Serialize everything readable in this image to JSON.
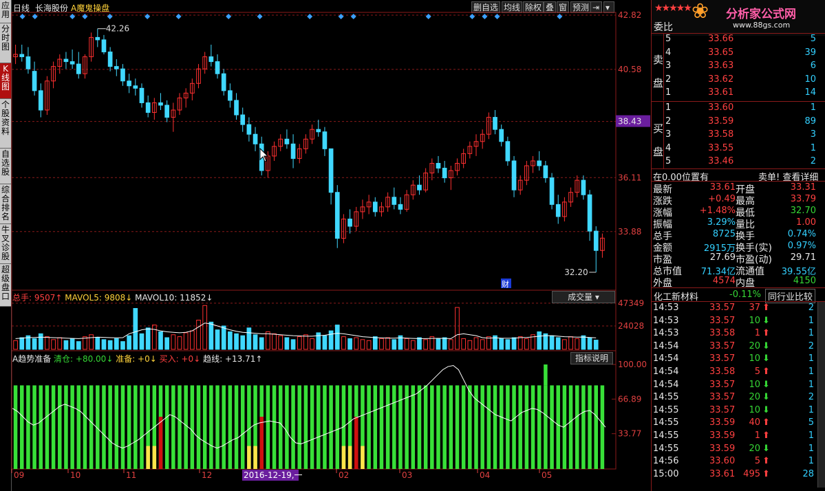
{
  "sidebar": {
    "tabs": [
      {
        "label": "应用",
        "active": false
      },
      {
        "label": "分时图",
        "active": false
      },
      {
        "label": "K线图",
        "active": true
      },
      {
        "label": "个股资料",
        "active": false
      },
      {
        "label": "自选股",
        "active": false
      },
      {
        "label": "综合排名",
        "active": false
      },
      {
        "label": "牛叉诊股",
        "active": false
      },
      {
        "label": "超级盘口",
        "active": false
      }
    ]
  },
  "toolbar": {
    "period": "日线",
    "stock": "长海股份",
    "indicator": "A魔鬼操盘",
    "buttons": [
      "删自选",
      "均线",
      "除权",
      "叠",
      "窗",
      "预测"
    ]
  },
  "chart_data": [
    {
      "type": "candlestick",
      "title": "日线",
      "y_ticks": [
        "42.82",
        "40.58",
        "38.43",
        "36.11",
        "33.88"
      ],
      "current_price_label": "38.43",
      "annotations": [
        "42.26",
        "32.20",
        "财"
      ],
      "ylim": [
        31.8,
        42.82
      ],
      "candles": [
        [
          41.1,
          41.6,
          40.8,
          41.2
        ],
        [
          41.2,
          41.6,
          40.9,
          41.1
        ],
        [
          41.1,
          41.5,
          40.4,
          40.6
        ],
        [
          40.5,
          40.9,
          39.5,
          39.7
        ],
        [
          39.7,
          40.0,
          38.6,
          38.9
        ],
        [
          38.9,
          40.3,
          38.7,
          40.1
        ],
        [
          40.1,
          40.9,
          39.8,
          40.7
        ],
        [
          40.7,
          41.2,
          40.4,
          41.0
        ],
        [
          41.0,
          41.3,
          40.6,
          40.9
        ],
        [
          40.9,
          41.4,
          40.6,
          40.8
        ],
        [
          40.8,
          41.3,
          40.2,
          40.4
        ],
        [
          40.4,
          41.2,
          40.2,
          41.1
        ],
        [
          41.1,
          42.1,
          40.9,
          41.9
        ],
        [
          41.9,
          42.26,
          41.5,
          41.8
        ],
        [
          41.8,
          42.0,
          41.2,
          41.3
        ],
        [
          41.3,
          41.5,
          40.5,
          40.7
        ],
        [
          40.7,
          41.0,
          40.3,
          40.6
        ],
        [
          40.6,
          40.8,
          39.9,
          40.1
        ],
        [
          40.1,
          40.4,
          39.6,
          39.9
        ],
        [
          39.9,
          40.2,
          39.5,
          39.8
        ],
        [
          39.8,
          40.0,
          39.0,
          39.2
        ],
        [
          39.2,
          39.5,
          38.6,
          38.8
        ],
        [
          38.8,
          39.4,
          38.5,
          39.2
        ],
        [
          39.2,
          39.6,
          38.9,
          39.1
        ],
        [
          39.1,
          39.3,
          38.4,
          38.6
        ],
        [
          38.6,
          39.2,
          38.0,
          38.9
        ],
        [
          38.9,
          39.6,
          38.7,
          39.4
        ],
        [
          39.4,
          39.8,
          39.0,
          39.6
        ],
        [
          39.6,
          40.2,
          39.3,
          40.0
        ],
        [
          40.0,
          40.8,
          39.8,
          40.6
        ],
        [
          40.6,
          41.3,
          40.4,
          41.1
        ],
        [
          41.1,
          41.6,
          40.7,
          40.9
        ],
        [
          40.9,
          41.2,
          40.2,
          40.4
        ],
        [
          40.4,
          40.6,
          39.5,
          39.7
        ],
        [
          39.7,
          40.0,
          39.0,
          39.3
        ],
        [
          39.3,
          39.6,
          38.5,
          38.7
        ],
        [
          38.7,
          39.0,
          38.0,
          38.3
        ],
        [
          38.3,
          38.6,
          37.6,
          37.9
        ],
        [
          37.9,
          38.2,
          37.2,
          37.5
        ],
        [
          37.5,
          37.8,
          36.2,
          36.4
        ],
        [
          36.4,
          37.2,
          36.1,
          37.0
        ],
        [
          37.0,
          37.6,
          36.8,
          37.4
        ],
        [
          37.4,
          37.9,
          37.2,
          37.7
        ],
        [
          37.7,
          38.1,
          37.3,
          37.5
        ],
        [
          37.5,
          37.9,
          36.5,
          36.9
        ],
        [
          36.9,
          37.5,
          36.7,
          37.3
        ],
        [
          37.3,
          37.9,
          37.1,
          37.7
        ],
        [
          37.7,
          38.3,
          37.5,
          38.1
        ],
        [
          38.1,
          38.5,
          37.8,
          38.0
        ],
        [
          38.0,
          38.2,
          37.0,
          37.3
        ],
        [
          37.3,
          36.5,
          35.0,
          35.5
        ],
        [
          35.5,
          35.8,
          33.2,
          33.6
        ],
        [
          33.6,
          34.6,
          33.4,
          34.4
        ],
        [
          34.4,
          34.8,
          33.8,
          34.1
        ],
        [
          34.1,
          34.9,
          33.9,
          34.7
        ],
        [
          34.7,
          35.2,
          34.4,
          34.9
        ],
        [
          34.9,
          35.4,
          34.6,
          35.1
        ],
        [
          35.1,
          35.3,
          34.5,
          34.7
        ],
        [
          34.7,
          35.1,
          34.5,
          34.9
        ],
        [
          34.9,
          35.5,
          34.7,
          35.3
        ],
        [
          35.3,
          35.7,
          34.8,
          35.0
        ],
        [
          35.0,
          35.3,
          34.6,
          34.8
        ],
        [
          34.8,
          35.6,
          34.7,
          35.4
        ],
        [
          35.4,
          36.0,
          35.2,
          35.8
        ],
        [
          35.8,
          36.2,
          35.4,
          35.6
        ],
        [
          35.6,
          36.5,
          35.5,
          36.3
        ],
        [
          36.3,
          36.9,
          36.0,
          36.7
        ],
        [
          36.7,
          37.0,
          36.3,
          36.5
        ],
        [
          36.5,
          36.8,
          35.9,
          36.1
        ],
        [
          36.1,
          36.6,
          35.6,
          36.4
        ],
        [
          36.4,
          36.9,
          36.2,
          36.7
        ],
        [
          36.7,
          37.3,
          36.5,
          37.1
        ],
        [
          37.1,
          37.6,
          36.9,
          37.4
        ],
        [
          37.4,
          37.9,
          37.0,
          37.6
        ],
        [
          37.6,
          38.1,
          37.3,
          37.9
        ],
        [
          37.9,
          38.8,
          37.7,
          38.6
        ],
        [
          38.6,
          38.9,
          37.9,
          38.1
        ],
        [
          38.1,
          38.3,
          37.4,
          37.6
        ],
        [
          37.6,
          37.8,
          36.6,
          36.8
        ],
        [
          36.8,
          37.0,
          35.3,
          35.6
        ],
        [
          35.6,
          36.2,
          35.4,
          36.0
        ],
        [
          36.0,
          36.8,
          35.8,
          36.6
        ],
        [
          36.6,
          37.0,
          36.3,
          36.8
        ],
        [
          36.8,
          37.2,
          36.4,
          36.6
        ],
        [
          36.6,
          36.8,
          35.9,
          36.1
        ],
        [
          36.1,
          36.3,
          34.8,
          35.0
        ],
        [
          35.0,
          35.4,
          34.2,
          34.5
        ],
        [
          34.5,
          35.3,
          34.3,
          35.1
        ],
        [
          35.1,
          35.7,
          34.9,
          35.5
        ],
        [
          35.5,
          36.2,
          35.3,
          36.0
        ],
        [
          36.0,
          36.2,
          35.2,
          35.4
        ],
        [
          35.4,
          35.6,
          33.5,
          33.9
        ],
        [
          33.9,
          34.1,
          32.2,
          33.1
        ],
        [
          33.1,
          33.8,
          32.8,
          33.61
        ]
      ]
    },
    {
      "type": "bar",
      "title": "成交量",
      "legend": [
        "总手: 9507↑",
        "MAVOL5: 9808↓",
        "MAVOL10: 11852↓"
      ],
      "y_ticks": [
        "47349",
        "24028"
      ],
      "ylim": [
        0,
        48000
      ],
      "values": [
        9000,
        12000,
        14000,
        11000,
        16000,
        13000,
        10000,
        12000,
        9000,
        11000,
        8000,
        13000,
        15000,
        12000,
        10000,
        9000,
        11000,
        8000,
        14000,
        42000,
        16000,
        22000,
        25000,
        18000,
        12000,
        15000,
        13000,
        17000,
        19000,
        30000,
        45000,
        28000,
        20000,
        24000,
        18000,
        16000,
        14000,
        22000,
        15000,
        12000,
        18000,
        16000,
        14000,
        12000,
        10000,
        13000,
        15000,
        11000,
        17000,
        14000,
        19000,
        25000,
        13000,
        11000,
        12000,
        10000,
        9000,
        13000,
        11000,
        12000,
        10000,
        14000,
        11000,
        9000,
        12000,
        10000,
        13000,
        11000,
        12000,
        10000,
        43000,
        11000,
        9000,
        12000,
        10000,
        13000,
        14000,
        11000,
        10000,
        12000,
        13000,
        11000,
        15000,
        18000,
        16000,
        14000,
        12000,
        10000,
        13000,
        11000,
        14000,
        12000,
        9507
      ],
      "ma_values": [
        11000,
        11500,
        12000,
        12200,
        12500,
        12300,
        12000,
        11800,
        11500,
        11200,
        11000,
        11500,
        12000,
        12500,
        12300,
        12000,
        11800,
        12000,
        16000,
        18000,
        20000,
        21000,
        20500,
        19000,
        18000,
        17500,
        17000,
        17500,
        19000,
        23000,
        27000,
        26000,
        24000,
        22000,
        20000,
        18500,
        17500,
        17000,
        16500,
        16000,
        16000,
        15500,
        15000,
        14500,
        14000,
        13800,
        13500,
        13500,
        14000,
        14500,
        15500,
        16500,
        16000,
        15000,
        14000,
        13000,
        12500,
        12000,
        11800,
        11500,
        11500,
        11800,
        11500,
        11200,
        11000,
        11000,
        11200,
        11300,
        11200,
        11000,
        15000,
        16000,
        15000,
        14000,
        12000,
        11500,
        11800,
        11500,
        11400,
        11500,
        12000,
        12200,
        12800,
        13500,
        14000,
        14000,
        13500,
        13000,
        12800,
        12500,
        12600,
        12200,
        11852
      ]
    },
    {
      "type": "bar",
      "title": "A趋势准备",
      "legend": [
        "清仓: +80.00↓",
        "准备: +0↓",
        "买入: +0↓",
        "趋线: +13.71↑"
      ],
      "y_ticks": [
        "100.00",
        "66.89",
        "33.77"
      ],
      "ylim": [
        0,
        100
      ],
      "clear_value": 80,
      "red_bars": [
        {
          "index": 23,
          "value": 50
        },
        {
          "index": 39,
          "value": 50
        },
        {
          "index": 54,
          "value": 50
        }
      ],
      "yellow_bars": [
        {
          "index": 21,
          "value": 22
        },
        {
          "index": 22,
          "value": 22
        },
        {
          "index": 37,
          "value": 22
        },
        {
          "index": 38,
          "value": 22
        },
        {
          "index": 52,
          "value": 22
        },
        {
          "index": 53,
          "value": 22
        },
        {
          "index": 55,
          "value": 22
        }
      ],
      "spike": {
        "index": 84,
        "value": 100
      },
      "trend_line": [
        58,
        55,
        50,
        45,
        42,
        44,
        48,
        52,
        56,
        60,
        62,
        60,
        58,
        55,
        50,
        45,
        40,
        35,
        30,
        25,
        22,
        20,
        22,
        25,
        28,
        32,
        36,
        40,
        44,
        48,
        52,
        50,
        46,
        42,
        38,
        32,
        28,
        25,
        22,
        20,
        22,
        25,
        28,
        30,
        34,
        38,
        42,
        44,
        45,
        46,
        45,
        44,
        38,
        30,
        25,
        24,
        26,
        28,
        30,
        32,
        34,
        36,
        38,
        40,
        44,
        48,
        50,
        52,
        54,
        56,
        58,
        60,
        62,
        64,
        66,
        68,
        70,
        72,
        76,
        80,
        85,
        90,
        95,
        98,
        99,
        95,
        85,
        75,
        68,
        64,
        60,
        56,
        52,
        50,
        48,
        46,
        50,
        54,
        56,
        58,
        57,
        54,
        50,
        46,
        42,
        40,
        44,
        48,
        52,
        55,
        56,
        52,
        46,
        40
      ]
    }
  ],
  "x_axis": {
    "labels": [
      "09",
      "10",
      "11",
      "12",
      "2016-12-19,一",
      "02",
      "03",
      "04",
      "05"
    ]
  },
  "buttons": {
    "volume_select": "成交量",
    "indicator_help": "指标说明"
  },
  "order_book": {
    "header": "委比",
    "sell_label": [
      "卖",
      "盘"
    ],
    "buy_label": [
      "买",
      "盘"
    ],
    "sell": [
      {
        "level": "5",
        "price": "33.66",
        "vol": "5"
      },
      {
        "level": "4",
        "price": "33.65",
        "vol": "39"
      },
      {
        "level": "3",
        "price": "33.63",
        "vol": "6"
      },
      {
        "level": "2",
        "price": "33.62",
        "vol": "10"
      },
      {
        "level": "1",
        "price": "33.61",
        "vol": "14"
      }
    ],
    "buy": [
      {
        "level": "1",
        "price": "33.60",
        "vol": "1"
      },
      {
        "level": "2",
        "price": "33.59",
        "vol": "89"
      },
      {
        "level": "3",
        "price": "33.58",
        "vol": "3"
      },
      {
        "level": "4",
        "price": "33.55",
        "vol": "1"
      },
      {
        "level": "5",
        "price": "33.46",
        "vol": "2"
      }
    ],
    "position": "在0.00位置有",
    "detail_link": "卖单! 查看详细"
  },
  "quote": [
    {
      "l1": "最新",
      "v1": "33.61",
      "c1": "red",
      "l2": "开盘",
      "v2": "33.31",
      "c2": "red"
    },
    {
      "l1": "涨跌",
      "v1": "+0.49",
      "c1": "red",
      "l2": "最高",
      "v2": "33.79",
      "c2": "red"
    },
    {
      "l1": "涨幅",
      "v1": "+1.48%",
      "c1": "red",
      "l2": "最低",
      "v2": "32.70",
      "c2": "grn"
    },
    {
      "l1": "振幅",
      "v1": "3.29%",
      "c1": "cyn",
      "l2": "量比",
      "v2": "1.00",
      "c2": "red"
    },
    {
      "l1": "总手",
      "v1": "8725",
      "c1": "cyn",
      "l2": "换手",
      "v2": "0.74%",
      "c2": "cyn"
    },
    {
      "l1": "金额",
      "v1": "2915万",
      "c1": "cyn",
      "l2": "换手(实)",
      "v2": "0.97%",
      "c2": "cyn"
    },
    {
      "l1": "市盈",
      "v1": "27.69",
      "c1": "wht",
      "l2": "市盈(动)",
      "v2": "29.71",
      "c2": "wht"
    },
    {
      "l1": "总市值",
      "v1": "71.34亿",
      "c1": "cyn",
      "l2": "流通值",
      "v2": "39.55亿",
      "c2": "cyn"
    },
    {
      "l1": "外盘",
      "v1": "4574",
      "c1": "red",
      "l2": "内盘",
      "v2": "4150",
      "c2": "grn"
    }
  ],
  "industry": {
    "name": "化工新材料",
    "change": "-0.11%",
    "compare": "同行业比较"
  },
  "ticks": [
    {
      "t": "14:53",
      "p": "33.57",
      "v": "37",
      "d": "up",
      "n": "2"
    },
    {
      "t": "14:53",
      "p": "33.57",
      "v": "10",
      "d": "down",
      "n": "1"
    },
    {
      "t": "14:53",
      "p": "33.58",
      "v": "1",
      "d": "up",
      "n": "1"
    },
    {
      "t": "14:54",
      "p": "33.57",
      "v": "20",
      "d": "down",
      "n": "2"
    },
    {
      "t": "14:54",
      "p": "33.57",
      "v": "10",
      "d": "down",
      "n": "1"
    },
    {
      "t": "14:54",
      "p": "33.58",
      "v": "5",
      "d": "up",
      "n": "1"
    },
    {
      "t": "14:54",
      "p": "33.57",
      "v": "10",
      "d": "down",
      "n": "1"
    },
    {
      "t": "14:55",
      "p": "33.57",
      "v": "20",
      "d": "down",
      "n": "2"
    },
    {
      "t": "14:55",
      "p": "33.57",
      "v": "10",
      "d": "down",
      "n": "1"
    },
    {
      "t": "14:55",
      "p": "33.59",
      "v": "40",
      "d": "up",
      "n": "5"
    },
    {
      "t": "14:55",
      "p": "33.59",
      "v": "1",
      "d": "up",
      "n": "1"
    },
    {
      "t": "14:55",
      "p": "33.59",
      "v": "20",
      "d": "down",
      "n": "1"
    },
    {
      "t": "14:56",
      "p": "33.60",
      "v": "5",
      "d": "up",
      "n": "1"
    },
    {
      "t": "15:00",
      "p": "33.61",
      "v": "495",
      "d": "up",
      "n": "28"
    }
  ],
  "logo": {
    "title": "分析家公式网",
    "url": "www.88gs.com"
  },
  "colors": {
    "up": "#ff3030",
    "down": "#40d8ff",
    "grid": "#8b1a1a",
    "green_bar": "#38e038",
    "yellow": "#ffe34a",
    "accent_purple": "#6a1e9e"
  }
}
